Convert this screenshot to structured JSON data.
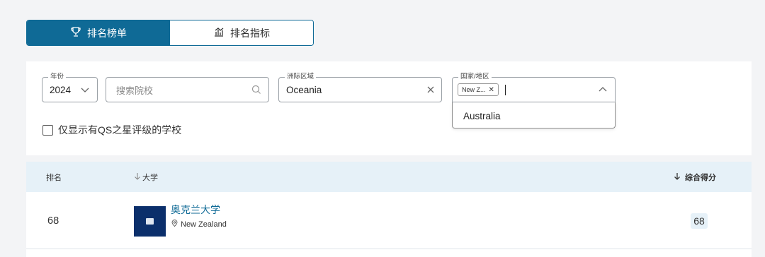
{
  "tabs": [
    {
      "label": "排名榜单",
      "icon": "trophy-icon"
    },
    {
      "label": "排名指标",
      "icon": "bar-chart-icon"
    }
  ],
  "filters": {
    "year": {
      "legend": "年份",
      "value": "2024"
    },
    "search": {
      "placeholder": "搜索院校"
    },
    "region": {
      "legend": "洲际区域",
      "value": "Oceania"
    },
    "country": {
      "legend": "国家/地区",
      "chip": "New Z..."
    },
    "dropdown_option": "Australia",
    "qs_stars_checkbox": "仅显示有QS之星评级的学校"
  },
  "table": {
    "headers": {
      "rank": "排名",
      "university": "大学",
      "score": "综合得分"
    },
    "rows": [
      {
        "rank": "68",
        "name": "奥克兰大学",
        "location": "New Zealand",
        "score": "68"
      }
    ]
  },
  "colors": {
    "accent": "#0f6a96",
    "header_bg": "#e6f1f8",
    "page_bg": "#f3f4f6"
  }
}
